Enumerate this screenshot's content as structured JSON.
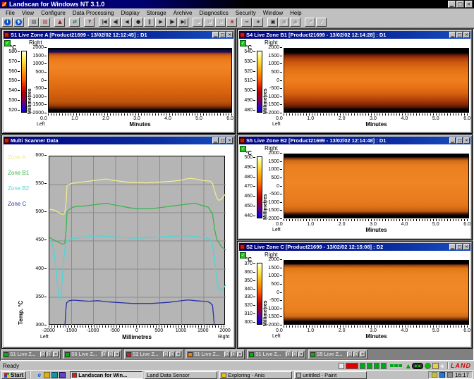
{
  "app": {
    "title": "Landscan for Windows NT 3.1.0"
  },
  "menu": {
    "items": [
      "File",
      "View",
      "Configure",
      "Data Processing",
      "Display",
      "Storage",
      "Archive",
      "Diagnostics",
      "Security",
      "Window",
      "Help"
    ]
  },
  "toolbar": {
    "groups": [
      [
        {
          "name": "info-button",
          "glyph": "i",
          "round": true
        },
        {
          "name": "currency-button",
          "glyph": "$",
          "round": true
        }
      ],
      [
        {
          "name": "print-button",
          "glyph": "▤",
          "color": "#303030"
        },
        {
          "name": "print-report-button",
          "glyph": "▤",
          "color": "#b02020"
        }
      ],
      [
        {
          "name": "alarm-button",
          "glyph": "▲",
          "color": "#c00000"
        }
      ],
      [
        {
          "name": "transfer-button",
          "glyph": "⇄",
          "color": "#006868"
        }
      ],
      [
        {
          "name": "help-button",
          "glyph": "?",
          "color": "#800000"
        }
      ],
      [
        {
          "name": "goto-start-button",
          "glyph": "|◀",
          "color": "#202020"
        },
        {
          "name": "step-back-button",
          "glyph": "◀|",
          "color": "#202020"
        },
        {
          "name": "play-back-button",
          "glyph": "◀",
          "color": "#202020"
        },
        {
          "name": "record-button",
          "glyph": "●",
          "color": "#202020"
        },
        {
          "name": "pause-button",
          "glyph": "||",
          "color": "#202020"
        },
        {
          "name": "play-button",
          "glyph": "▶",
          "color": "#202020"
        },
        {
          "name": "step-forward-button",
          "glyph": "|▶",
          "color": "#202020"
        },
        {
          "name": "goto-end-button",
          "glyph": "▶|",
          "color": "#202020"
        }
      ],
      [
        {
          "name": "zoom-in-button",
          "glyph": "⊕",
          "disabled": true
        },
        {
          "name": "zoom-out-button",
          "glyph": "⊖",
          "disabled": true
        },
        {
          "name": "zoom-area-button",
          "glyph": "⊘",
          "disabled": true
        },
        {
          "name": "scale-adjust-button",
          "glyph": "±",
          "color": "#c00000"
        }
      ],
      [
        {
          "name": "decrease-button",
          "glyph": "−",
          "color": "#202020"
        },
        {
          "name": "increase-button",
          "glyph": "+",
          "color": "#202020"
        }
      ],
      [
        {
          "name": "save-button",
          "glyph": "▣",
          "color": "#202020"
        },
        {
          "name": "save-copy-button",
          "glyph": "▣",
          "disabled": true
        },
        {
          "name": "export-button",
          "glyph": "▣",
          "disabled": true
        }
      ],
      [
        {
          "name": "annotate-button",
          "glyph": "↗",
          "disabled": true
        },
        {
          "name": "edit-button",
          "glyph": "⁄",
          "disabled": true
        }
      ]
    ]
  },
  "scanners": [
    {
      "title": "S1 Live Zone A [Product21699 - 13/02/02 12:12:45] : D1",
      "unit": "°C",
      "scale_ticks": [
        "580",
        "570",
        "560",
        "550",
        "540",
        "530",
        "520"
      ],
      "axis_top": "Right",
      "axis_bottom": "Left",
      "y_label": "Millimetres",
      "y_ticks": [
        "2000",
        "1500",
        "1000",
        "500",
        "0",
        "-500",
        "-1000",
        "-1500",
        "-2000"
      ],
      "x_ticks": [
        "0.0",
        "1.0",
        "2.0",
        "3.0",
        "4.0",
        "5.0",
        "6.0"
      ],
      "x_label": "Minutes"
    },
    {
      "title": "S4 Live Zone B1 [Product21699 - 13/02/02 12:14:28] : D1",
      "unit": "°C",
      "scale_ticks": [
        "540",
        "530",
        "520",
        "510",
        "500",
        "490",
        "480"
      ],
      "axis_top": "Right",
      "axis_bottom": "Left",
      "y_label": "Millimetres",
      "y_ticks": [
        "2000",
        "1500",
        "1000",
        "500",
        "0",
        "-500",
        "-1000",
        "-1500",
        "-2000"
      ],
      "x_ticks": [
        "0.0",
        "1.0",
        "2.0",
        "3.0",
        "4.0",
        "5.0",
        "6.0"
      ],
      "x_label": "Minutes"
    },
    {
      "title": "S5 Live Zone B2 [Product21699 - 13/02/02 12:14:48] : D1",
      "unit": "°C",
      "scale_ticks": [
        "500",
        "490",
        "480",
        "470",
        "460",
        "450",
        "440"
      ],
      "axis_top": "Right",
      "axis_bottom": "Left",
      "y_label": "Millimetres",
      "y_ticks": [
        "2000",
        "1500",
        "1000",
        "500",
        "0",
        "-500",
        "-1000",
        "-1500",
        "-2000"
      ],
      "x_ticks": [
        "0.0",
        "1.0",
        "2.0",
        "3.0",
        "4.0",
        "5.0",
        "6.0"
      ],
      "x_label": "Minutes"
    },
    {
      "title": "S2 Live Zone C [Product21699 - 13/02/02 12:15:08] : D2",
      "unit": "°C",
      "scale_ticks": [
        "370",
        "360",
        "350",
        "340",
        "330",
        "320",
        "310",
        "300"
      ],
      "axis_top": "Right",
      "axis_bottom": "Left",
      "y_label": "Millimetres",
      "y_ticks": [
        "2000",
        "1500",
        "1000",
        "500",
        "0",
        "-500",
        "-1000",
        "-1500",
        "-2000"
      ],
      "x_ticks": [
        "0.0",
        "1.0",
        "2.0",
        "3.0",
        "4.0",
        "5.0",
        "6.0"
      ],
      "x_label": "Minutes"
    }
  ],
  "multi": {
    "title": "Multi Scanner Data",
    "y_label": "Temp. °C",
    "x_label": "Millimetres",
    "corner_left": "Left",
    "corner_right": "Right"
  },
  "chart_data": {
    "type": "line",
    "title": "Multi Scanner Data",
    "xlabel": "Millimetres",
    "ylabel": "Temp. °C",
    "xlim": [
      -2000,
      2000
    ],
    "ylim": [
      300,
      600
    ],
    "x_ticks": [
      -2000,
      -1500,
      -1000,
      -500,
      0,
      500,
      1000,
      1500,
      2000
    ],
    "y_ticks": [
      600,
      550,
      500,
      450,
      400,
      350,
      300
    ],
    "grid": true,
    "legend_position": "left",
    "series": [
      {
        "name": "Zone A",
        "color": "#eeec8c",
        "points": [
          [
            -2000,
            506
          ],
          [
            -1900,
            505
          ],
          [
            -1800,
            501
          ],
          [
            -1700,
            497
          ],
          [
            -1650,
            499
          ],
          [
            -1620,
            520
          ],
          [
            -1600,
            548
          ],
          [
            -1500,
            552
          ],
          [
            -1400,
            553
          ],
          [
            -1200,
            555
          ],
          [
            -1000,
            557
          ],
          [
            -800,
            559
          ],
          [
            -700,
            560
          ],
          [
            -600,
            558
          ],
          [
            -400,
            556
          ],
          [
            -200,
            554
          ],
          [
            0,
            554
          ],
          [
            200,
            553
          ],
          [
            400,
            554
          ],
          [
            600,
            555
          ],
          [
            800,
            556
          ],
          [
            1000,
            558
          ],
          [
            1100,
            560
          ],
          [
            1200,
            561
          ],
          [
            1300,
            560
          ],
          [
            1500,
            557
          ],
          [
            1650,
            556
          ],
          [
            1700,
            552
          ],
          [
            1750,
            538
          ],
          [
            1800,
            526
          ],
          [
            1850,
            522
          ],
          [
            1900,
            524
          ],
          [
            1950,
            529
          ],
          [
            2000,
            534
          ]
        ]
      },
      {
        "name": "Zone B1",
        "color": "#3cb44c",
        "points": [
          [
            -2000,
            456
          ],
          [
            -1900,
            452
          ],
          [
            -1800,
            448
          ],
          [
            -1700,
            444
          ],
          [
            -1650,
            446
          ],
          [
            -1620,
            470
          ],
          [
            -1600,
            502
          ],
          [
            -1500,
            509
          ],
          [
            -1400,
            511
          ],
          [
            -1200,
            512
          ],
          [
            -1000,
            514
          ],
          [
            -800,
            516
          ],
          [
            -700,
            517
          ],
          [
            -600,
            515
          ],
          [
            -400,
            512
          ],
          [
            -200,
            509
          ],
          [
            0,
            507
          ],
          [
            200,
            507
          ],
          [
            400,
            508
          ],
          [
            600,
            510
          ],
          [
            800,
            512
          ],
          [
            1000,
            514
          ],
          [
            1200,
            516
          ],
          [
            1300,
            517
          ],
          [
            1500,
            512
          ],
          [
            1600,
            510
          ],
          [
            1700,
            498
          ],
          [
            1750,
            470
          ],
          [
            1800,
            452
          ],
          [
            1900,
            440
          ],
          [
            2000,
            434
          ]
        ]
      },
      {
        "name": "Zone B2",
        "color": "#4cd6d6",
        "points": [
          [
            -2000,
            452
          ],
          [
            -1950,
            448
          ],
          [
            -1900,
            434
          ],
          [
            -1850,
            400
          ],
          [
            -1800,
            362
          ],
          [
            -1770,
            345
          ],
          [
            -1740,
            352
          ],
          [
            -1700,
            390
          ],
          [
            -1660,
            430
          ],
          [
            -1620,
            449
          ],
          [
            -1500,
            454
          ],
          [
            -1300,
            456
          ],
          [
            -1100,
            458
          ],
          [
            -900,
            459
          ],
          [
            -700,
            458
          ],
          [
            -500,
            457
          ],
          [
            -300,
            456
          ],
          [
            -100,
            455
          ],
          [
            100,
            455
          ],
          [
            300,
            456
          ],
          [
            500,
            457
          ],
          [
            700,
            458
          ],
          [
            900,
            459
          ],
          [
            1100,
            459
          ],
          [
            1300,
            458
          ],
          [
            1500,
            456
          ],
          [
            1650,
            453
          ],
          [
            1700,
            443
          ],
          [
            1750,
            415
          ],
          [
            1800,
            378
          ],
          [
            1850,
            363
          ],
          [
            1900,
            362
          ],
          [
            1950,
            366
          ],
          [
            2000,
            372
          ]
        ]
      },
      {
        "name": "Zone C",
        "color": "#2830a0",
        "points": [
          [
            -1660,
            290
          ],
          [
            -1640,
            308
          ],
          [
            -1625,
            328
          ],
          [
            -1610,
            340
          ],
          [
            -1550,
            344
          ],
          [
            -1450,
            345
          ],
          [
            -1300,
            344
          ],
          [
            -1100,
            343
          ],
          [
            -900,
            344
          ],
          [
            -700,
            342
          ],
          [
            -500,
            341
          ],
          [
            -300,
            340
          ],
          [
            -100,
            339
          ],
          [
            100,
            339
          ],
          [
            300,
            339
          ],
          [
            500,
            340
          ],
          [
            700,
            341
          ],
          [
            900,
            343
          ],
          [
            1100,
            345
          ],
          [
            1200,
            345
          ],
          [
            1300,
            344
          ],
          [
            1500,
            343
          ],
          [
            1600,
            342
          ],
          [
            1650,
            340
          ],
          [
            1700,
            336
          ],
          [
            1720,
            320
          ],
          [
            1740,
            300
          ],
          [
            1750,
            288
          ]
        ]
      }
    ]
  },
  "minimized": [
    {
      "title": "S1 Live Z...",
      "icon": "green"
    },
    {
      "title": "S6 Live Z...",
      "icon": "green"
    },
    {
      "title": "S2 Live Z...",
      "icon": "red"
    },
    {
      "title": "S1 Live Z...",
      "icon": "orange"
    },
    {
      "title": "S1 Live Z...",
      "icon": "green"
    },
    {
      "title": "S5 Live Z...",
      "icon": "green"
    }
  ],
  "statusbar": {
    "ready": "Ready",
    "brand": "LAND"
  },
  "taskbar": {
    "start": "Start",
    "tasks": [
      {
        "label": "Landscan for Win...",
        "icon": "landscan",
        "active": true
      },
      {
        "label": "Land Data Sensor",
        "icon": "none",
        "active": false
      },
      {
        "label": "Exploring - Anis",
        "icon": "explorer",
        "active": false
      },
      {
        "label": "untitled - Paint",
        "icon": "paint",
        "active": false
      }
    ],
    "time": "16:17"
  },
  "colors": {
    "titlebar": "#000080",
    "land_red": "#d80000",
    "plot_bg": "#b5b5b5",
    "mdi_bg": "#808080"
  }
}
